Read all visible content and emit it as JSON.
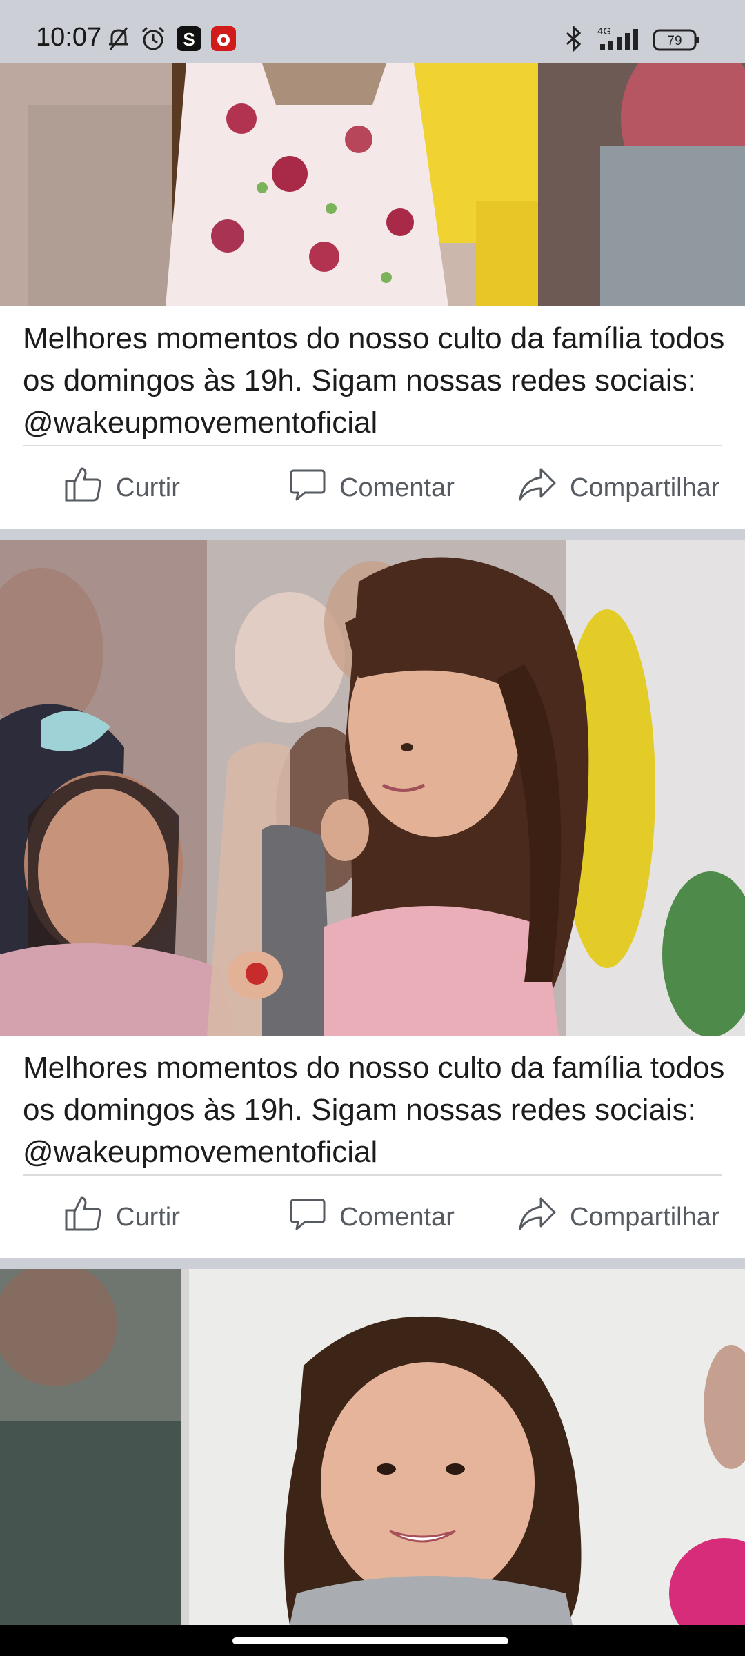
{
  "status_bar": {
    "time": "10:07",
    "network": "4G",
    "battery": "79",
    "icons": [
      "mute-bell-icon",
      "alarm-icon",
      "s-app-icon",
      "red-app-icon",
      "bluetooth-icon",
      "signal-icon",
      "battery-icon"
    ]
  },
  "posts": [
    {
      "caption": "Melhores momentos do nosso culto da família todos os domingos às 19h. Sigam nossas redes sociais: @wakeupmovementoficial",
      "actions": {
        "like": "Curtir",
        "comment": "Comentar",
        "share": "Compartilhar"
      }
    },
    {
      "caption": "Melhores momentos do nosso culto da família todos os domingos às 19h. Sigam nossas redes sociais: @wakeupmovementoficial",
      "actions": {
        "like": "Curtir",
        "comment": "Comentar",
        "share": "Compartilhar"
      }
    }
  ],
  "colors": {
    "background": "#ffffff",
    "separator": "#ccd0d6",
    "action_text": "#555b61",
    "caption_text": "#1c1c1c"
  }
}
